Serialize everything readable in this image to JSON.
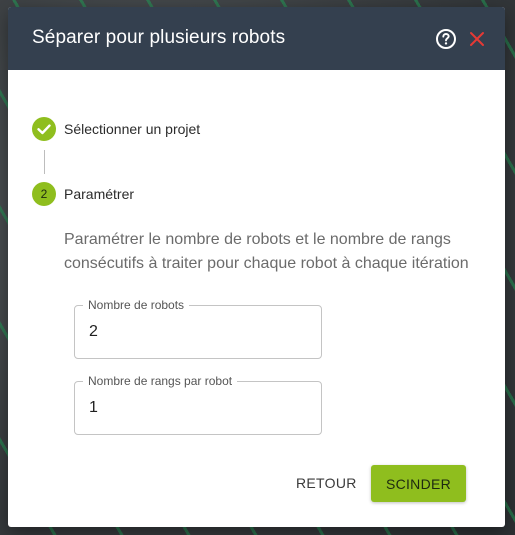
{
  "dialog": {
    "title": "Séparer pour plusieurs robots",
    "help_icon": "help-circle-icon",
    "close_icon": "close-icon",
    "accent_color": "#8fbe1e",
    "close_color": "#e53935",
    "header_color": "#34404f"
  },
  "steps": [
    {
      "label": "Sélectionner un projet",
      "status": "completed",
      "icon": "check-icon"
    },
    {
      "number": "2",
      "label": "Paramétrer",
      "status": "active"
    }
  ],
  "description": "Paramétrer le nombre de robots et le nombre de rangs consécutifs à traiter pour chaque robot à chaque itération",
  "fields": {
    "robots": {
      "label": "Nombre de robots",
      "value": "2"
    },
    "rows_per_robot": {
      "label": "Nombre de rangs par robot",
      "value": "1"
    }
  },
  "actions": {
    "back_label": "RETOUR",
    "split_label": "SCINDER"
  }
}
